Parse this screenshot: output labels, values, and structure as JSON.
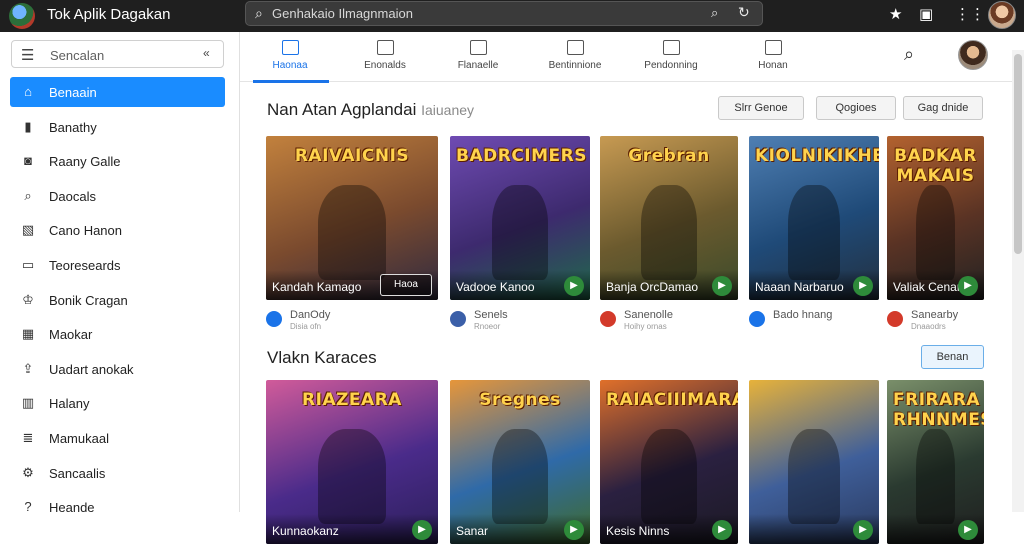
{
  "app": {
    "title": "Tok Aplik Dagakan"
  },
  "topbar": {
    "search_value": "Genhakaio Ilmagnmaion",
    "icons": [
      "search-icon",
      "clear-icon",
      "refresh-icon",
      "star-icon",
      "bookmark-icon",
      "grid-icon"
    ]
  },
  "sidebar": {
    "search_label": "Sencalan",
    "items": [
      {
        "label": "Benaain",
        "icon": "home-icon",
        "active": true
      },
      {
        "label": "Banathy",
        "icon": "book-icon"
      },
      {
        "label": "Raany Galle",
        "icon": "gamepad-icon"
      },
      {
        "label": "Daocals",
        "icon": "search-icon"
      },
      {
        "label": "Cano Hanon",
        "icon": "image-icon"
      },
      {
        "label": "Teoreseards",
        "icon": "card-icon"
      },
      {
        "label": "Bonik Cragan",
        "icon": "trophy-icon"
      },
      {
        "label": "Maokar",
        "icon": "grid-icon"
      },
      {
        "label": "Uadart anokak",
        "icon": "upload-icon"
      },
      {
        "label": "Halany",
        "icon": "chart-icon"
      },
      {
        "label": "Mamukaal",
        "icon": "list-icon"
      },
      {
        "label": "Sancaalis",
        "icon": "settings-icon"
      },
      {
        "label": "Heande",
        "icon": "help-icon"
      }
    ]
  },
  "tabs": [
    {
      "label": "Haonaa",
      "active": true
    },
    {
      "label": "Enonalds"
    },
    {
      "label": "Flanaelle"
    },
    {
      "label": "Bentinnione"
    },
    {
      "label": "Pendonning"
    },
    {
      "label": "Honan"
    }
  ],
  "section1": {
    "title": "Nan Atan Agplandai",
    "title_muted": "Iaiuaney",
    "filters": [
      "Slrr Genoe",
      "Qogioes",
      "Gag dnide"
    ],
    "cards": [
      {
        "banner": "RAIVAICNIS",
        "caption": "Kandah Kamago",
        "action": "Haoa",
        "meta": "DanOdy",
        "sub": "Disia ofn",
        "colors": [
          "#7a4a2e",
          "#c2813d",
          "#2f2a40"
        ],
        "meta_color": "#1a73e8"
      },
      {
        "banner": "BADRCIMERS",
        "caption": "Vadooe Kanoo",
        "action": "",
        "meta": "Senels",
        "sub": "Rnoeor",
        "colors": [
          "#3d2a6e",
          "#6f4bb3",
          "#1f6b4a"
        ],
        "meta_color": "#3b5fa8"
      },
      {
        "banner": "Grebran",
        "caption": "Banja OrcDamao",
        "action": "",
        "meta": "Sanenolle",
        "sub": "Hoihy ornas",
        "colors": [
          "#6b5a2e",
          "#c79a52",
          "#3a4a2a"
        ],
        "meta_color": "#d33a2a"
      },
      {
        "banner": "KIOLNIKIKHE",
        "caption": "Naaan Narbaruo",
        "action": "",
        "meta": "Bado hnang",
        "sub": "",
        "colors": [
          "#1f4a78",
          "#4f7fb3",
          "#23303f"
        ],
        "meta_color": "#1a73e8"
      },
      {
        "banner": "BADKAR MAKAIS",
        "caption": "Valiak Cenan",
        "action": "",
        "meta": "Sanearby",
        "sub": "Dnaaodrs",
        "colors": [
          "#5a3324",
          "#b3622f",
          "#222"
        ],
        "meta_color": "#d33a2a"
      }
    ]
  },
  "section2": {
    "title": "Vlakn Karaces",
    "button": "Benan",
    "cards": [
      {
        "banner": "RIAZEARA",
        "caption": "Kunnaokanz",
        "colors": [
          "#4a2b8a",
          "#d15b9a",
          "#2c1f5a"
        ]
      },
      {
        "banner": "Sregnes",
        "caption": "Sanar",
        "colors": [
          "#2f6aa8",
          "#e6963a",
          "#3f6b2a"
        ]
      },
      {
        "banner": "RAIACIIIMARA",
        "caption": "Kesis Ninns",
        "colors": [
          "#2a2040",
          "#e0702a",
          "#1c1a24"
        ]
      },
      {
        "banner": "",
        "caption": "",
        "colors": [
          "#3f5f9a",
          "#e7b23a",
          "#2a3a5f"
        ]
      },
      {
        "banner": "FRIRARA RHNNMES",
        "caption": "",
        "colors": [
          "#2a3a30",
          "#7a8f6a",
          "#1f1f1f"
        ]
      }
    ]
  }
}
